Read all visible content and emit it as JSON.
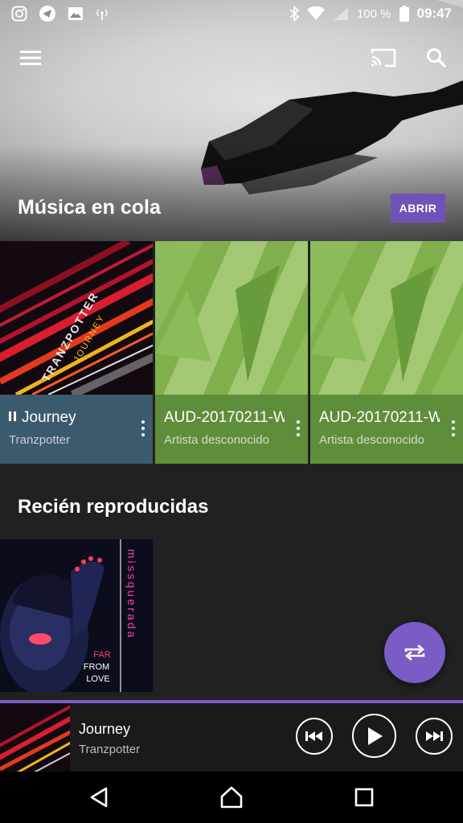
{
  "status_bar": {
    "battery": "100 %",
    "time": "09:47",
    "left_icons": [
      "instagram-icon",
      "telegram-icon",
      "image-icon",
      "radio-tower-icon"
    ],
    "right_icons": [
      "bluetooth-icon",
      "wifi-icon",
      "signal-icon",
      "battery-icon"
    ]
  },
  "toolbar": {
    "menu_icon": "hamburger-menu-icon",
    "cast_icon": "cast-icon",
    "search_icon": "search-icon"
  },
  "hero": {
    "title": "Música en cola",
    "open_label": "ABRIR"
  },
  "queue": [
    {
      "title": "Journey",
      "artist": "Tranzpotter",
      "playing": true,
      "art_text": "TRANZPOTTER",
      "art_subtext": "JOURNEY",
      "color": "#3b5a6e"
    },
    {
      "title": "AUD-20170211-W",
      "artist": "Artista desconocido",
      "playing": false,
      "color": "#5f8e3a"
    },
    {
      "title": "AUD-20170211-W",
      "artist": "Artista desconocido",
      "playing": false,
      "color": "#5f8e3a"
    }
  ],
  "recent": {
    "title": "Recién reproducidas",
    "items": [
      {
        "art_vertical": "missquerada",
        "art_caption": [
          "FAR",
          "FROM",
          "LOVE"
        ]
      }
    ]
  },
  "fab": {
    "icon": "repeat-icon"
  },
  "mini_player": {
    "title": "Journey",
    "artist": "Tranzpotter",
    "prev_icon": "skip-previous-icon",
    "play_icon": "play-icon",
    "next_icon": "skip-next-icon"
  },
  "nav": {
    "back_icon": "back-icon",
    "home_icon": "home-icon",
    "recents_icon": "recents-icon"
  },
  "colors": {
    "accent": "#7b5cc4",
    "button": "#6f53b8",
    "background": "#212121",
    "playing_card": "#3b5a6e",
    "unknown_card": "#5f8e3a"
  }
}
